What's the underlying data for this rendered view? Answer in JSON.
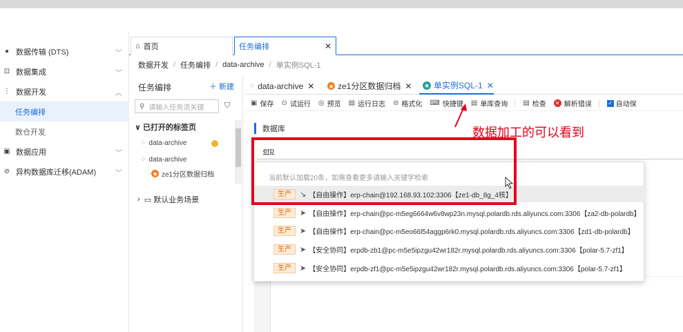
{
  "leftnav": {
    "items": [
      {
        "label": "数据传输 (DTS)",
        "icon": "globe-icon"
      },
      {
        "label": "数据集成",
        "icon": "integration-icon"
      },
      {
        "label": "数据开发",
        "icon": "dev-icon"
      },
      {
        "label": "任务编排",
        "icon": ""
      },
      {
        "label": "数仓开发",
        "icon": ""
      },
      {
        "label": "数据应用",
        "icon": "app-icon"
      },
      {
        "label": "异构数据库迁移(ADAM)",
        "icon": "migrate-icon"
      }
    ]
  },
  "maintabs": {
    "home": "首页",
    "task": "任务编排"
  },
  "breadcrumb": [
    "数据开发",
    "任务编排",
    "data-archive",
    "单实例SQL-1"
  ],
  "taskpanel": {
    "title": "任务编排",
    "new_label": "新建",
    "search_placeholder": "请输入任务流关键",
    "group": "已打开的标签页",
    "items": [
      "data-archive",
      "data-archive",
      "ze1分区数据归档"
    ],
    "scene": "默认业务场景"
  },
  "editor_tabs": [
    "data-archive",
    "ze1分区数据归档",
    "单实例SQL-1"
  ],
  "toolbar": [
    "保存",
    "试运行",
    "预览",
    "运行日志",
    "格式化",
    "快捷键",
    "单库查询",
    "检查",
    "解析错误",
    "自动保"
  ],
  "database": {
    "label": "数据库",
    "value": "erp"
  },
  "dropdown": {
    "hint": "当前默认加载20条，如需查看更多请输入关键字检索",
    "env": "生产",
    "rows": [
      "【自由操作】erp-chain@192.168.93.102:3306【ze1-db_8g_4核】",
      "【自由操作】erp-chain@pc-m5eg6664w6v8wp23n.mysql.polardb.rds.aliyuncs.com:3306【za2-db-polardb】",
      "【自由操作】erp-chain@pc-m5eo66l54aggp6rk0.mysql.polardb.rds.aliyuncs.com:3306【zd1-db-polardb】",
      "【安全协同】erpdb-zb1@pc-m5e5ipzgu42wr182r.mysql.polardb.rds.aliyuncs.com:3306【polar-5.7-zf1】",
      "【安全协同】erpdb-zf1@pc-m5e5ipzgu42wr182r.mysql.polardb.rds.aliyuncs.com:3306【polar-5.7-zf1】"
    ]
  },
  "annotation": {
    "text": "数据加工的可以看到",
    "color": "#e5001a"
  },
  "colors": {
    "accent": "#1a6fd8",
    "env_badge": "#e06c12"
  }
}
